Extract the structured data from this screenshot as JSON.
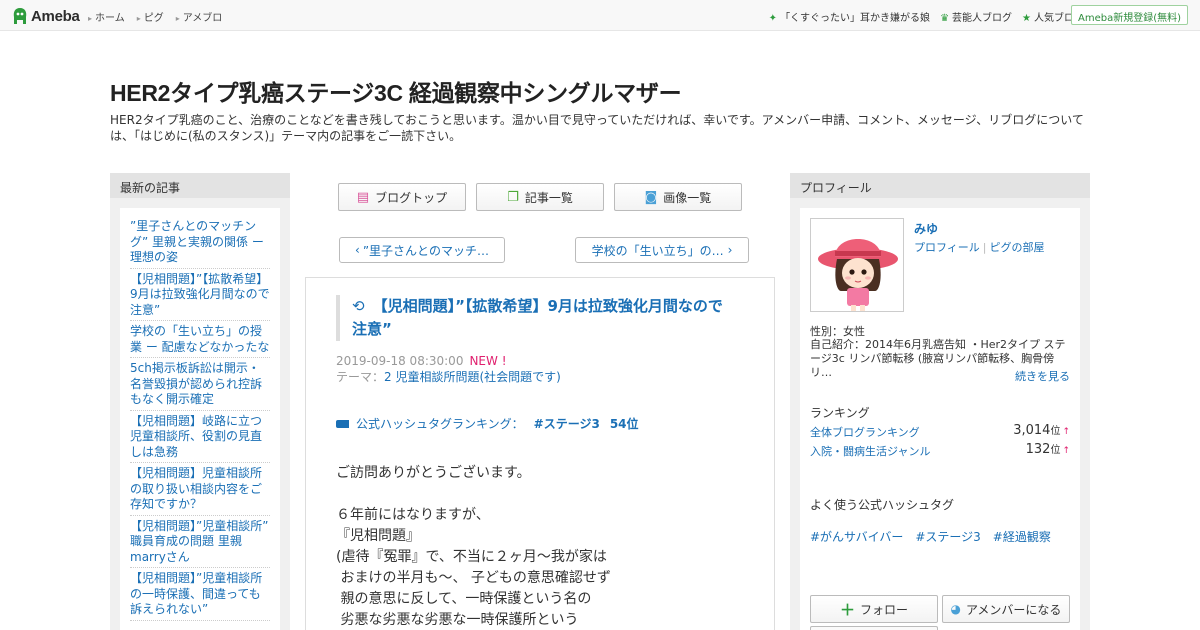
{
  "topbar": {
    "logo_text": "Ameba",
    "nav": [
      "ホーム",
      "ピグ",
      "アメブロ"
    ],
    "right_links": [
      {
        "icon": "sparkle-icon",
        "label": "「くすぐったい」耳かき嫌がる娘"
      },
      {
        "icon": "crown-icon",
        "label": "芸能人ブログ"
      },
      {
        "icon": "star-icon",
        "label": "人気ブログ"
      }
    ],
    "signup_label": "Ameba新規登録(無料)"
  },
  "blog": {
    "title": "HER2タイプ乳癌ステージ3C 経過観察中シングルマザー",
    "description": "HER2タイプ乳癌のこと、治療のことなどを書き残しておこうと思います。温かい目で見守っていただければ、幸いです。アメンバー申請、コメント、メッセージ、リブログについては、「はじめに(私のスタンス)」テーマ内の記事をご一読下さい。"
  },
  "left": {
    "heading": "最新の記事",
    "recent": [
      "”里子さんとのマッチング” 里親と実親の関係 ー 理想の姿",
      "【児相問題】”【拡散希望】9月は拉致強化月間なので注意”",
      "学校の「生い立ち」の授業 ー 配慮などなかったな",
      "5ch掲示板訴訟は開示・名誉毀損が認められ控訴もなく開示確定",
      "【児相問題】岐路に立つ児童相談所、役割の見直しは急務",
      "【児相問題】児童相談所の取り扱い相談内容をご存知ですか？",
      "【児相問題】”児童相談所” 職員育成の問題 里親marryさん",
      "【児相問題】”児童相談所の一時保護、間違っても訴えられない”"
    ]
  },
  "center": {
    "buttons": [
      {
        "icon": "blog-top-icon",
        "label": "ブログトップ"
      },
      {
        "icon": "article-list-icon",
        "label": "記事一覧"
      },
      {
        "icon": "camera-icon",
        "label": "画像一覧"
      }
    ],
    "prev_label": "”里子さんとのマッチ…",
    "next_label": "学校の「生い立ち」の…",
    "entry": {
      "title": "【児相問題】”【拡散希望】9月は拉致強化月間なので注意”",
      "date": "2019-09-18 08:30:00",
      "new_label": "NEW !",
      "theme_label": "テーマ：",
      "theme": "2 児童相談所問題(社会問題です)",
      "hash_label": "公式ハッシュタグランキング：",
      "hash_tag": "#ステージ3",
      "hash_rank": "54位",
      "body": "ご訪問ありがとうございます。\n\n６年前にはなりますが、\n『児相問題』\n(虐待『冤罪』で、不当に２ヶ月～我が家は\n おまけの半月も～、 子どもの意思確認せず\n 親の意思に反して、一時保護という名の\n 劣悪な劣悪な劣悪な一時保護所という"
    }
  },
  "right": {
    "heading": "プロフィール",
    "name": "みゆ",
    "profile_link": "プロフィール",
    "pig_link": "ピグの部屋",
    "gender": "性別：女性",
    "intro": "自己紹介：2014年6月乳癌告知 ・Her2タイプ ステージ3c リンパ節転移 (腋窩リンパ節転移、胸骨傍リ…",
    "more_label": "続きを見る",
    "ranking_heading": "ランキング",
    "rankings": [
      {
        "label": "全体ブログランキング",
        "value": "3,014",
        "unit": "位",
        "arrow": "↑"
      },
      {
        "label": "入院・闘病生活ジャンル",
        "value": "132",
        "unit": "位",
        "arrow": "↑"
      }
    ],
    "tags_heading": "よく使う公式ハッシュタグ",
    "tags": [
      "#がんサバイバー",
      "#ステージ3",
      "#経過観察"
    ],
    "follow_label": "フォロー",
    "amember_label": "アメンバーになる"
  },
  "colors": {
    "link": "#1a6fb5",
    "ameba_green": "#2e9c3d",
    "new_pink": "#e0206e"
  }
}
